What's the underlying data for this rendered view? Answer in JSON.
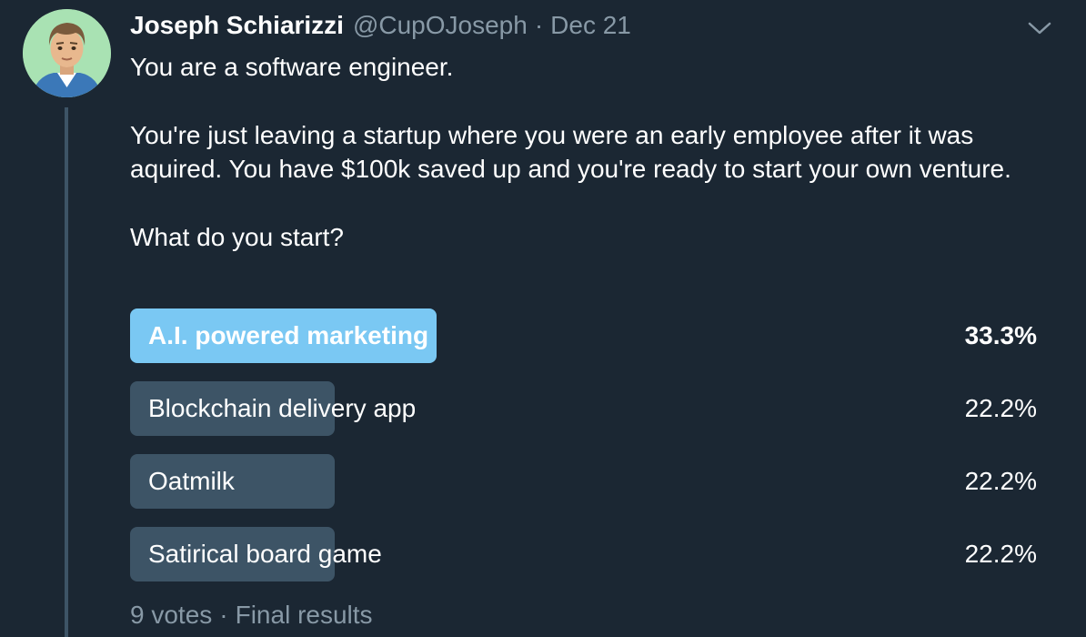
{
  "tweet": {
    "author_name": "Joseph Schiarizzi",
    "handle": "@CupOJoseph",
    "separator": "·",
    "date": "Dec 21",
    "menu_icon": "chevron-down-icon",
    "avatar_icon": "avatar-illustration",
    "paragraphs": [
      "You are a software engineer.",
      "You're just leaving a startup where you were an early employee after it was aquired. You have $100k saved up and you're ready to start your own venture.",
      "What do you start?"
    ]
  },
  "poll": {
    "options": [
      {
        "label": "A.I. powered marketing",
        "percent": "33.3%",
        "fraction": 0.333,
        "winner": true
      },
      {
        "label": "Blockchain delivery app",
        "percent": "22.2%",
        "fraction": 0.222,
        "winner": false
      },
      {
        "label": "Oatmilk",
        "percent": "22.2%",
        "fraction": 0.222,
        "winner": false
      },
      {
        "label": "Satirical board game",
        "percent": "22.2%",
        "fraction": 0.222,
        "winner": false
      }
    ],
    "votes": "9 votes",
    "separator": "·",
    "status": "Final results"
  },
  "colors": {
    "background": "#1b2733",
    "winner_bar": "#7ac8f3",
    "bar": "#3d5466",
    "muted_text": "#8899a6"
  }
}
